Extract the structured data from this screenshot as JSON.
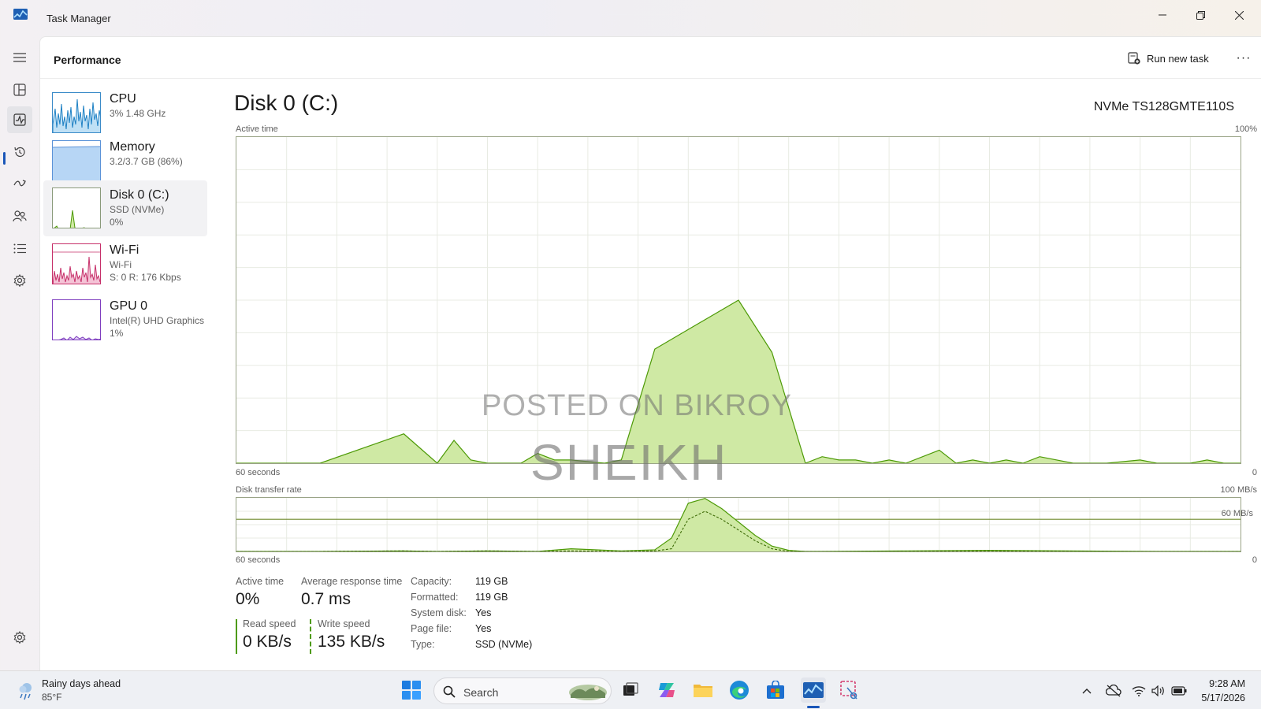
{
  "window": {
    "title": "Task Manager"
  },
  "header": {
    "title": "Performance",
    "run_new_task": "Run new task",
    "more_label": "···"
  },
  "rail": {
    "items": [
      "menu",
      "processes",
      "performance",
      "app-history",
      "startup-apps",
      "users",
      "details",
      "services"
    ],
    "active": "performance",
    "settings": "settings"
  },
  "devices": [
    {
      "name": "CPU",
      "sub1": "3% 1.48 GHz",
      "sub2": "",
      "color": "#1d80c4"
    },
    {
      "name": "Memory",
      "sub1": "3.2/3.7 GB (86%)",
      "sub2": "",
      "color": "#5b93d8"
    },
    {
      "name": "Disk 0 (C:)",
      "sub1": "SSD (NVMe)",
      "sub2": "0%",
      "color": "#4d9a06"
    },
    {
      "name": "Wi-Fi",
      "sub1": "Wi-Fi",
      "sub2": "S: 0 R: 176 Kbps",
      "color": "#c6306a"
    },
    {
      "name": "GPU 0",
      "sub1": "Intel(R) UHD Graphics",
      "sub2": "1%",
      "color": "#7f3fbf"
    }
  ],
  "detail": {
    "title": "Disk 0 (C:)",
    "model": "NVMe TS128GMTE110S",
    "active_time_graph": {
      "label": "Active time",
      "max": "100%",
      "time_left": "60 seconds",
      "time_right": "0"
    },
    "transfer_graph": {
      "label": "Disk transfer rate",
      "max": "100 MB/s",
      "ref_line": "60 MB/s",
      "time_left": "60 seconds",
      "time_right": "0"
    },
    "stats": {
      "active_time_label": "Active time",
      "active_time_value": "0%",
      "avg_response_label": "Average response time",
      "avg_response_value": "0.7 ms",
      "read_speed_label": "Read speed",
      "read_speed_value": "0 KB/s",
      "write_speed_label": "Write speed",
      "write_speed_value": "135 KB/s"
    },
    "properties": [
      {
        "key": "Capacity:",
        "value": "119 GB"
      },
      {
        "key": "Formatted:",
        "value": "119 GB"
      },
      {
        "key": "System disk:",
        "value": "Yes"
      },
      {
        "key": "Page file:",
        "value": "Yes"
      },
      {
        "key": "Type:",
        "value": "SSD (NVMe)"
      }
    ]
  },
  "watermark": {
    "line1": "POSTED ON BIKROY",
    "line2": "SHEIKH"
  },
  "taskbar": {
    "weather_text": "Rainy days ahead",
    "weather_temp": "85°F",
    "search_placeholder": "Search",
    "apps": [
      "start",
      "search",
      "task-view",
      "copilot",
      "file-explorer",
      "edge",
      "store",
      "task-manager",
      "snipping-tool"
    ],
    "active_app": "task-manager",
    "time": "9:28 AM",
    "date": "5/17/2026"
  },
  "colors": {
    "disk_green": "#4d9a06",
    "disk_fill": "#cfe9a4",
    "accent": "#1a56b8"
  },
  "chart_data": [
    {
      "type": "area",
      "title": "Active time",
      "ylim": [
        0,
        100
      ],
      "xlim": [
        60,
        0
      ],
      "xlabel": "60 seconds",
      "x": [
        60,
        55,
        50,
        48,
        47,
        46,
        45,
        43,
        42,
        41,
        40,
        38,
        37,
        35,
        30,
        28,
        26,
        25,
        24,
        23,
        22,
        21,
        20,
        18,
        17,
        16,
        15,
        14,
        13,
        12,
        10,
        8,
        6,
        5,
        4,
        3,
        2,
        1,
        0
      ],
      "values": [
        0,
        0,
        9,
        0,
        7,
        1,
        0,
        0,
        3,
        1,
        1,
        0,
        1,
        35,
        50,
        34,
        0,
        2,
        1,
        1,
        0,
        1,
        0,
        4,
        0,
        1,
        0,
        1,
        0,
        2,
        0,
        0,
        1,
        0,
        0,
        0,
        1,
        0,
        0
      ]
    },
    {
      "type": "area",
      "title": "Disk transfer rate",
      "ylim": [
        0,
        100
      ],
      "reference_line": 60,
      "xlabel": "60 seconds",
      "series": [
        {
          "x": [
            60,
            55,
            50,
            48,
            45,
            42,
            40,
            37,
            35,
            34,
            33,
            32,
            31,
            30,
            29,
            28,
            27,
            26,
            25,
            20,
            15,
            10,
            5,
            0
          ],
          "values": [
            0,
            0,
            1,
            0,
            1,
            0,
            5,
            1,
            3,
            25,
            90,
            99,
            80,
            55,
            30,
            10,
            2,
            0,
            0,
            1,
            2,
            1,
            0,
            0
          ]
        },
        {
          "x": [
            60,
            55,
            50,
            48,
            45,
            42,
            40,
            37,
            35,
            34,
            33,
            32,
            31,
            30,
            29,
            28,
            27,
            26,
            25,
            20,
            15,
            10,
            5,
            0
          ],
          "values": [
            0,
            0,
            1,
            0,
            1,
            0,
            1,
            0,
            1,
            5,
            60,
            75,
            60,
            40,
            20,
            5,
            0,
            0,
            0,
            0,
            1,
            0,
            0,
            0
          ]
        }
      ]
    }
  ]
}
